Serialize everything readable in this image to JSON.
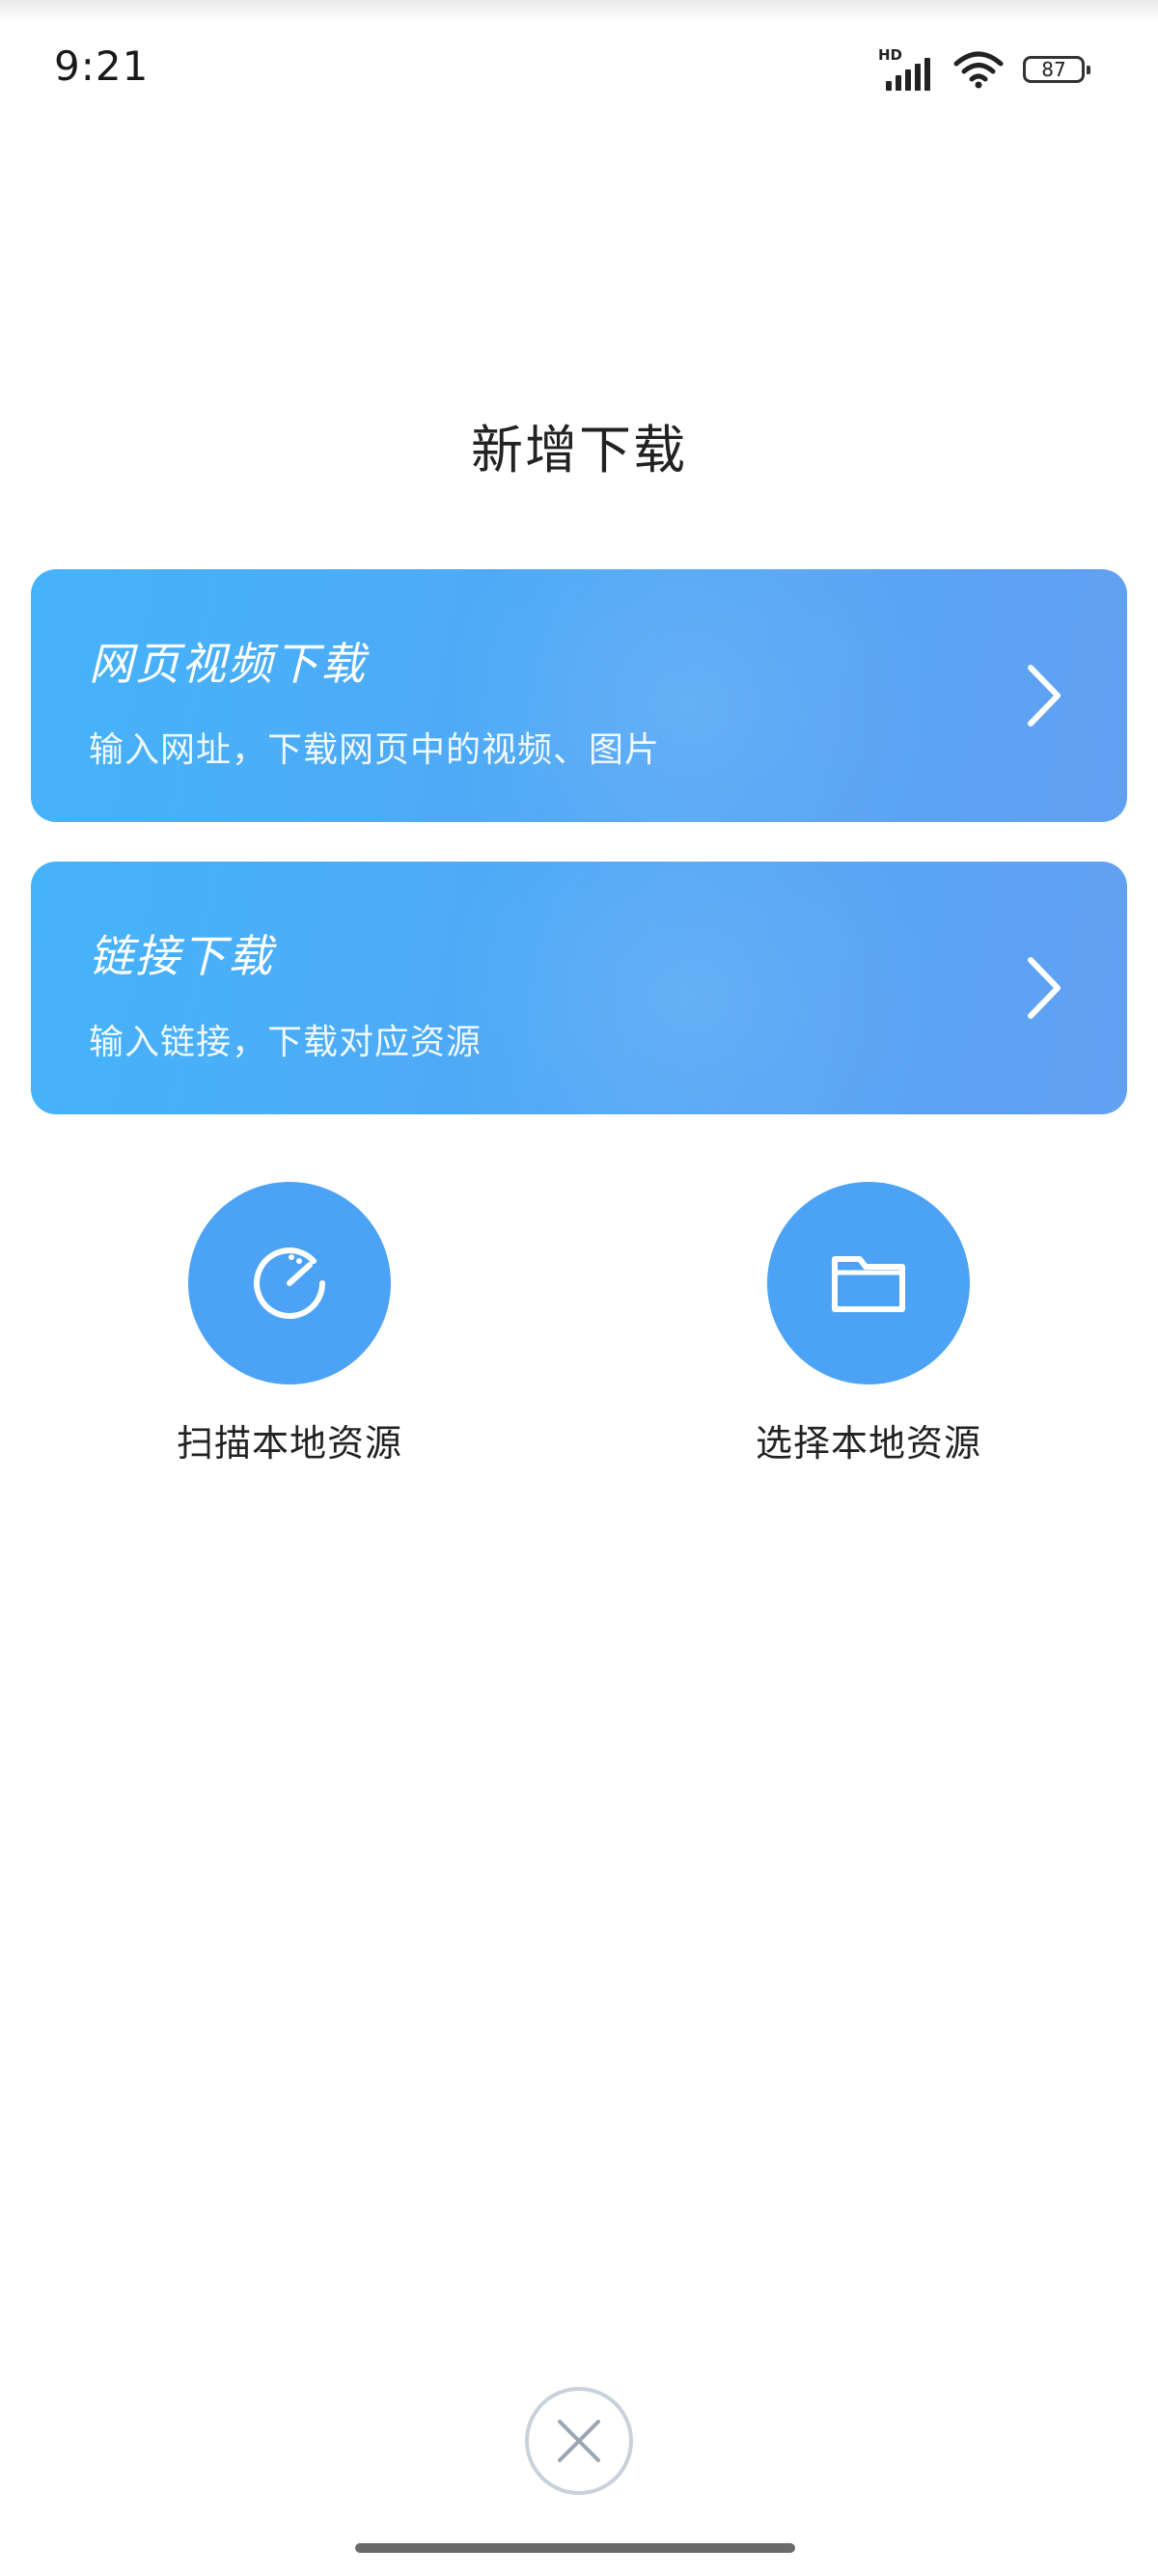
{
  "status_bar": {
    "time": "9:21",
    "network_label": "HD",
    "battery_level": "87",
    "icons": [
      "signal-icon",
      "wifi-icon",
      "battery-icon"
    ]
  },
  "page": {
    "title": "新增下载"
  },
  "cards": [
    {
      "title": "网页视频下载",
      "subtitle": "输入网址，下载网页中的视频、图片",
      "icon": "chevron-right-icon"
    },
    {
      "title": "链接下载",
      "subtitle": "输入链接，下载对应资源",
      "icon": "chevron-right-icon"
    }
  ],
  "actions": [
    {
      "label": "扫描本地资源",
      "icon": "scan-icon"
    },
    {
      "label": "选择本地资源",
      "icon": "folder-icon"
    }
  ],
  "close": {
    "icon": "close-icon"
  },
  "colors": {
    "card_gradient_start": "#45b3fb",
    "card_gradient_end": "#62a0f2",
    "action_circle": "#4ca3f5",
    "close_ring": "#c9d2da",
    "title_text": "#222222"
  }
}
